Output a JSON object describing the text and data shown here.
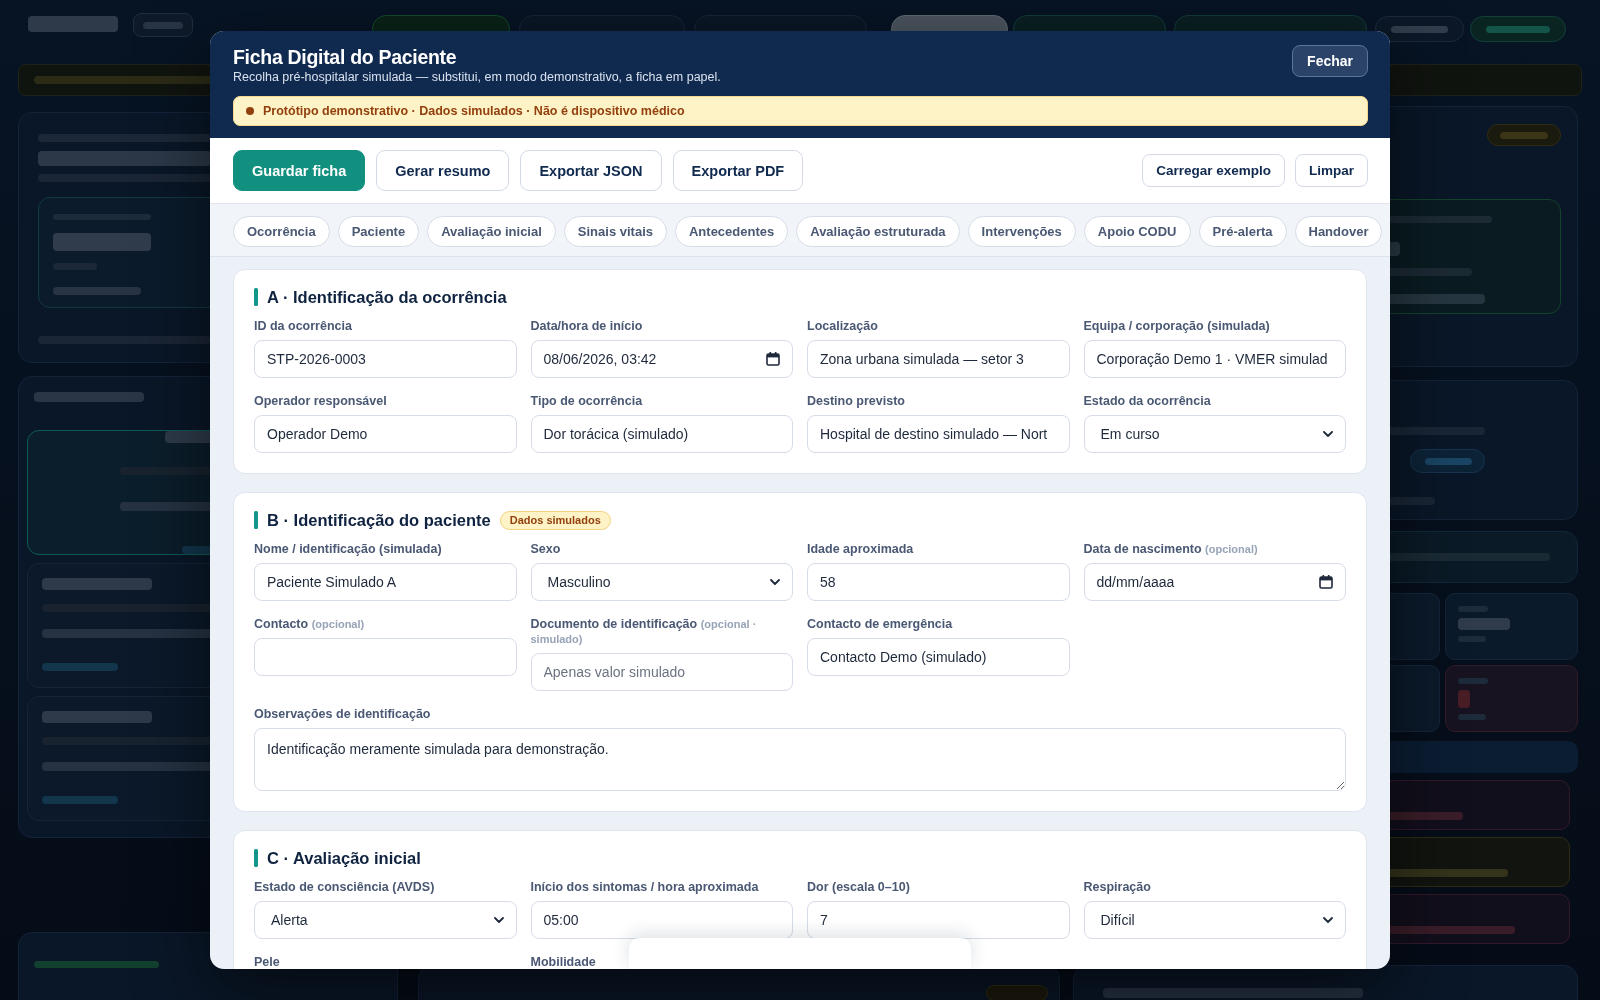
{
  "modal": {
    "title": "Ficha Digital do Paciente",
    "subtitle": "Recolha pré-hospitalar simulada — substitui, em modo demonstrativo, a ficha em papel.",
    "close": "Fechar",
    "notice": "Protótipo demonstrativo · Dados simulados · Não é dispositivo médico",
    "actions": [
      {
        "label": "Guardar ficha",
        "kind": "primary"
      },
      {
        "label": "Gerar resumo",
        "kind": "secondary"
      },
      {
        "label": "Exportar JSON",
        "kind": "secondary"
      },
      {
        "label": "Exportar PDF",
        "kind": "secondary"
      }
    ],
    "side_actions": [
      "Carregar exemplo",
      "Limpar"
    ],
    "tabs": [
      {
        "label": "Ocorrência",
        "selected": false
      },
      {
        "label": "Paciente",
        "selected": false
      },
      {
        "label": "Avaliação inicial",
        "selected": false
      },
      {
        "label": "Sinais vitais",
        "selected": false
      },
      {
        "label": "Antecedentes",
        "selected": false
      },
      {
        "label": "Avaliação estruturada",
        "selected": false
      },
      {
        "label": "Intervenções",
        "selected": false
      },
      {
        "label": "Apoio CODU",
        "selected": false
      },
      {
        "label": "Pré-alerta",
        "selected": false
      },
      {
        "label": "Handover",
        "selected": false
      }
    ],
    "sections": [
      {
        "title": "A · Identificação da ocorrência",
        "fields": [
          {
            "label": "ID da ocorrência",
            "kind": "text",
            "value": "STP-2026-0003"
          },
          {
            "label": "Data/hora de início",
            "kind": "date",
            "value": "08/06/2026, 03:42"
          },
          {
            "label": "Localização",
            "kind": "text",
            "value": "Zona urbana simulada — setor 3"
          },
          {
            "label": "Equipa / corporação (simulada)",
            "kind": "text",
            "value": "Corporação Demo 1 · VMER simulad"
          },
          {
            "label": "Operador responsável",
            "kind": "text",
            "value": "Operador Demo"
          },
          {
            "label": "Tipo de ocorrência",
            "kind": "text",
            "value": "Dor torácica (simulado)"
          },
          {
            "label": "Destino previsto",
            "kind": "text",
            "value": "Hospital de destino simulado — Nort"
          },
          {
            "label": "Estado da ocorrência",
            "kind": "select",
            "value": "Em curso"
          }
        ]
      },
      {
        "title": "B · Identificação do paciente",
        "badge": "Dados simulados",
        "fields": [
          {
            "label": "Nome / identificação (simulada)",
            "kind": "text",
            "value": "Paciente Simulado A"
          },
          {
            "label": "Sexo",
            "kind": "select",
            "value": "Masculino"
          },
          {
            "label": "Idade aproximada",
            "kind": "text",
            "value": "58"
          },
          {
            "label": "Data de nascimento",
            "note": "(opcional)",
            "kind": "date",
            "placeholder": "dd/mm/aaaa"
          },
          {
            "label": "Contacto",
            "note": "(opcional)",
            "kind": "text"
          },
          {
            "label": "Documento de identificação",
            "note": "(opcional · simulado)",
            "kind": "text",
            "placeholder": "Apenas valor simulado"
          },
          {
            "label": "Contacto de emergência",
            "kind": "text",
            "value": "Contacto Demo (simulado)"
          },
          {
            "label": "Observações de identificação",
            "kind": "textarea",
            "value": "Identificação meramente simulada para demonstração."
          }
        ]
      },
      {
        "title": "C · Avaliação inicial",
        "fields": [
          {
            "label": "Estado de consciência (AVDS)",
            "kind": "select",
            "value": "Alerta"
          },
          {
            "label": "Início dos sintomas / hora aproximada",
            "kind": "text",
            "value": "05:00"
          },
          {
            "label": "Dor (escala 0–10)",
            "kind": "text",
            "value": "7"
          },
          {
            "label": "Respiração",
            "kind": "select",
            "value": "Difícil"
          },
          {
            "label": "Pele"
          },
          {
            "label": "Mobilidade"
          }
        ]
      }
    ]
  }
}
